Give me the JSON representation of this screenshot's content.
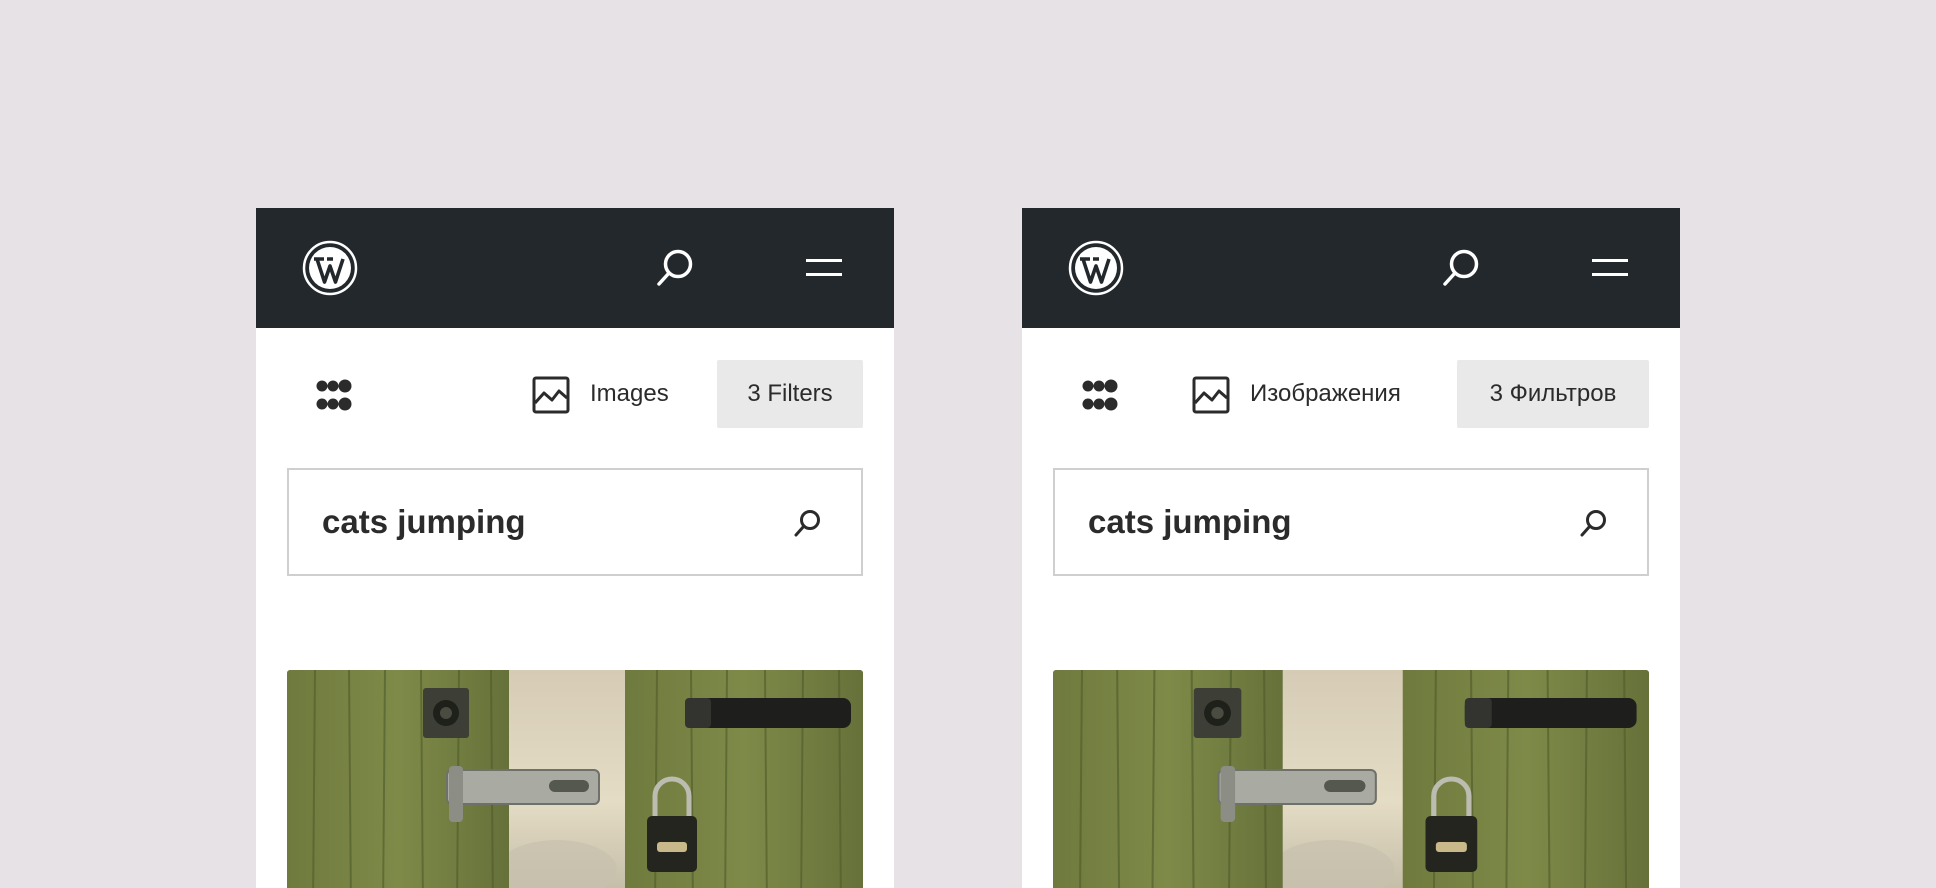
{
  "colors": {
    "background": "#e7e2e6",
    "topbar": "#23282d",
    "panel": "#ffffff",
    "filter_button_bg": "#e9e9e9",
    "text": "#2b2b2b",
    "input_border": "#cfcfcf"
  },
  "icons": {
    "logo": "wordpress-logo-icon",
    "header_search": "search-icon",
    "menu": "hamburger-menu-icon",
    "layout": "grid-view-icon",
    "media_type": "image-icon",
    "search_submit": "search-icon"
  },
  "screens": [
    {
      "locale": "en",
      "media_type_label": "Images",
      "filters_label": "3 Filters",
      "search": {
        "value": "cats jumping"
      }
    },
    {
      "locale": "ru",
      "media_type_label": "Изображения",
      "filters_label": "3 Фильтров",
      "search": {
        "value": "cats jumping"
      }
    }
  ]
}
